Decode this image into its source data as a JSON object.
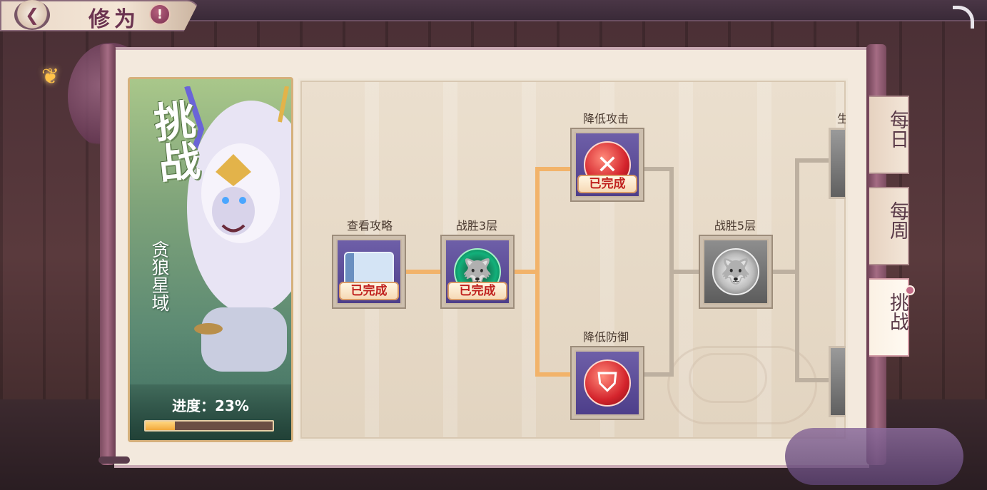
{
  "header": {
    "title": "修为",
    "back_icon": "back-arrow-icon",
    "info_label": "!"
  },
  "challenge_card": {
    "heading": "挑战",
    "realm_name": "贪狼星域",
    "progress_text": "进度：23%",
    "progress_value": 0.23,
    "colors": {
      "fill": "#f2a93b",
      "track": "#6b4e44"
    }
  },
  "tree": {
    "nodes": [
      {
        "id": "guide",
        "label": "查看攻略",
        "icon": "scroll-icon",
        "status": "已完成"
      },
      {
        "id": "win3",
        "label": "战胜3层",
        "icon": "wolf-icon",
        "status": "已完成"
      },
      {
        "id": "lower_atk",
        "label": "降低攻击",
        "icon": "sword-down-icon",
        "status": "已完成"
      },
      {
        "id": "lower_def",
        "label": "降低防御",
        "icon": "shield-icon",
        "status": ""
      },
      {
        "id": "win5",
        "label": "战胜5层",
        "icon": "wolf-icon",
        "status": ""
      }
    ],
    "partial_labels": {
      "top": "生",
      "bottom": ""
    }
  },
  "tabs": [
    {
      "label": "每日",
      "active": false
    },
    {
      "label": "每周",
      "active": false
    },
    {
      "label": "挑战",
      "active": true
    }
  ]
}
